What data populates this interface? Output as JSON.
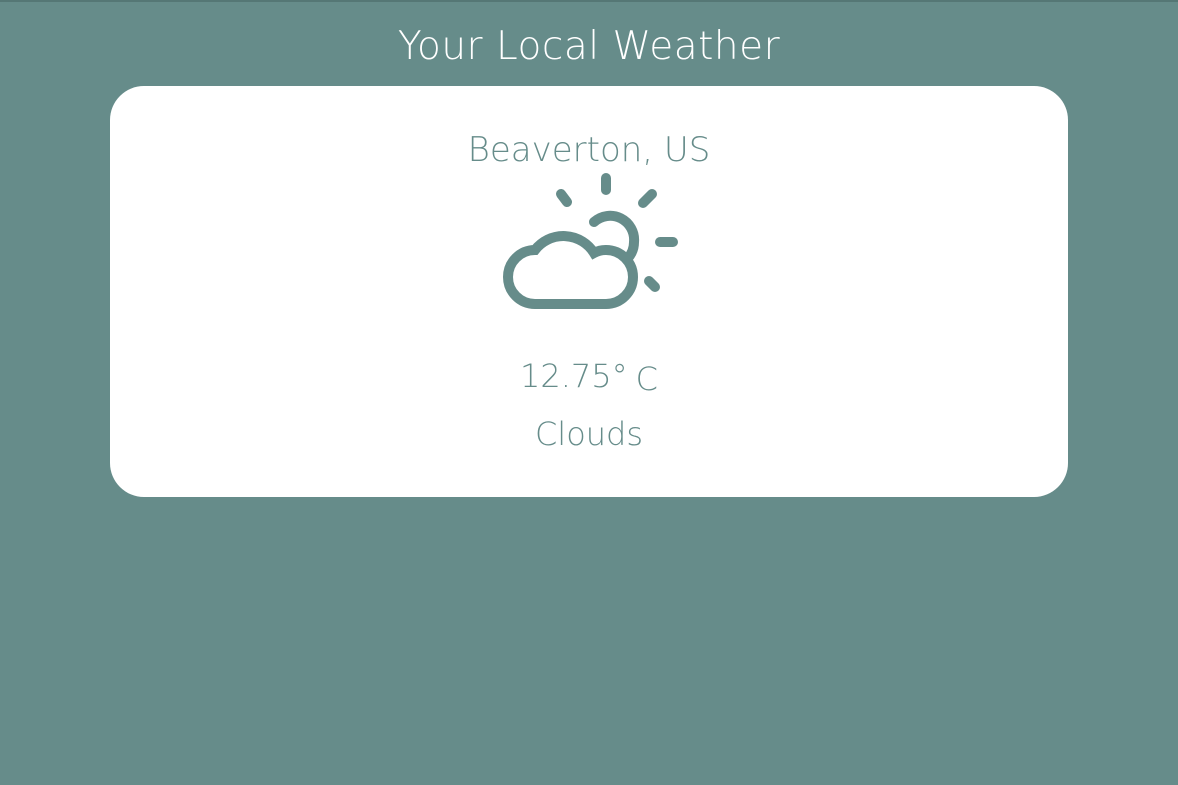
{
  "header": {
    "title": "Your Local Weather"
  },
  "weather": {
    "location": "Beaverton, US",
    "icon": "partly-cloudy-icon",
    "temperature": "12.75°",
    "unit": "C",
    "condition": "Clouds"
  },
  "colors": {
    "background": "#668c8a",
    "card": "#ffffff",
    "accent": "#668c8a",
    "title_text": "#ffffff"
  }
}
